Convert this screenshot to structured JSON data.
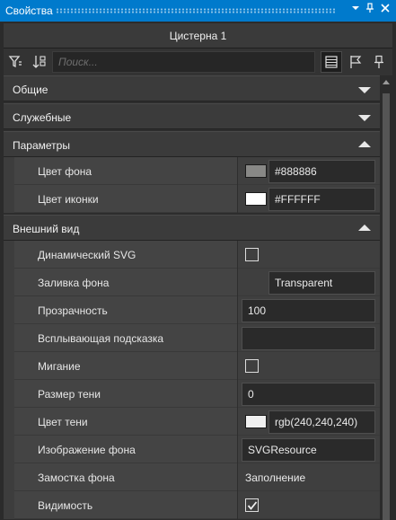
{
  "window": {
    "title": "Свойства"
  },
  "header": {
    "object_title": "Цистерна 1"
  },
  "toolbar": {
    "icons": [
      "filter-icon",
      "sort-icon",
      "list-view-icon",
      "flag-icon",
      "pin-icon"
    ],
    "search_placeholder": "Поиск..."
  },
  "sections": {
    "general": {
      "label": "Общие",
      "expanded": false
    },
    "service": {
      "label": "Служебные",
      "expanded": false
    },
    "parameters": {
      "label": "Параметры",
      "expanded": true
    },
    "appearance": {
      "label": "Внешний вид",
      "expanded": true
    }
  },
  "rows": {
    "bg_color": {
      "name": "Цвет фона",
      "value": "#888886",
      "color": "#888886"
    },
    "icon_color": {
      "name": "Цвет иконки",
      "value": "#FFFFFF",
      "color": "#FFFFFF"
    },
    "dynamic_svg": {
      "name": "Динамический SVG",
      "checked": false
    },
    "bg_fill": {
      "name": "Заливка фона",
      "value": "Transparent"
    },
    "opacity": {
      "name": "Прозрачность",
      "value": "100"
    },
    "tooltip": {
      "name": "Всплывающая подсказка",
      "value": ""
    },
    "blink": {
      "name": "Мигание",
      "checked": false
    },
    "shadow_size": {
      "name": "Размер тени",
      "value": "0"
    },
    "shadow_color": {
      "name": "Цвет тени",
      "value": "rgb(240,240,240)",
      "color": "#F0F0F0"
    },
    "bg_image": {
      "name": "Изображение фона",
      "value": "SVGResource"
    },
    "bg_tiling": {
      "name": "Замостка фона",
      "value": "Заполнение"
    },
    "visibility": {
      "name": "Видимость",
      "checked": true
    }
  },
  "colors": {
    "accent": "#007ACC",
    "panel": "#2D2D2D",
    "section": "#3B3B3B"
  }
}
